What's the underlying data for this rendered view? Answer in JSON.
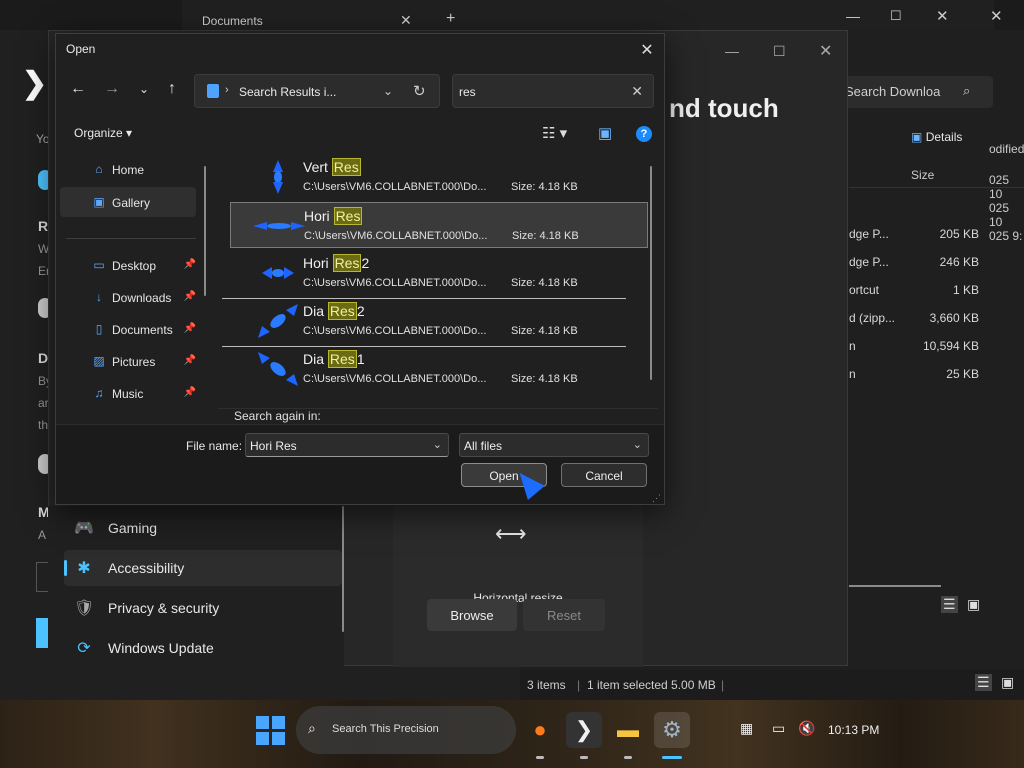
{
  "bg_explorer": {
    "tab_title": "Documents",
    "search_placeholder": "Search Downloa",
    "details_label": "Details",
    "col_size": "Size",
    "col_modified": "odified",
    "dates": [
      "025 10",
      "025 10",
      "025 9:"
    ],
    "rows": [
      {
        "name": "dge P...",
        "size": "205 KB"
      },
      {
        "name": "dge P...",
        "size": "246 KB"
      },
      {
        "name": "ortcut",
        "size": "1 KB"
      },
      {
        "name": "d (zipp...",
        "size": "3,660 KB"
      },
      {
        "name": "n",
        "size": "10,594 KB"
      },
      {
        "name": "n",
        "size": "25 KB"
      }
    ],
    "status": {
      "items": "3 items",
      "selected": "1 item selected  5.00 MB"
    }
  },
  "settings": {
    "fragments": [
      "Yo",
      "R",
      "W",
      "Er",
      "D",
      "By",
      "ar",
      "th",
      "M",
      "A"
    ],
    "nav": [
      {
        "label": "Gaming",
        "icon": "🎮"
      },
      {
        "label": "Accessibility",
        "icon": "✱"
      },
      {
        "label": "Privacy & security",
        "icon": "🛡"
      },
      {
        "label": "Windows Update",
        "icon": "⟳"
      }
    ]
  },
  "mouse_panel": {
    "heading": "nd touch",
    "preview_label": "Horizontal resize",
    "preview_glyph": "⟷",
    "browse": "Browse",
    "reset": "Reset"
  },
  "dialog": {
    "title": "Open",
    "address": "Search Results i...",
    "search_value": "res",
    "organize": "Organize",
    "sidebar": [
      {
        "label": "Home",
        "icon": "⌂",
        "pinned": false
      },
      {
        "label": "Gallery",
        "icon": "▣",
        "pinned": false
      },
      {
        "label": "Desktop",
        "icon": "▭",
        "pinned": true
      },
      {
        "label": "Downloads",
        "icon": "↓",
        "pinned": true
      },
      {
        "label": "Documents",
        "icon": "▯",
        "pinned": true
      },
      {
        "label": "Pictures",
        "icon": "▨",
        "pinned": true
      },
      {
        "label": "Music",
        "icon": "♫",
        "pinned": true
      }
    ],
    "files": [
      {
        "pre": "Vert ",
        "hl": "Res",
        "post": "",
        "path": "C:\\Users\\VM6.COLLABNET.000\\Do...",
        "size": "Size: 4.18 KB",
        "kind": "vert"
      },
      {
        "pre": "Hori ",
        "hl": "Res",
        "post": "",
        "path": "C:\\Users\\VM6.COLLABNET.000\\Do...",
        "size": "Size: 4.18 KB",
        "kind": "hori"
      },
      {
        "pre": "Hori ",
        "hl": "Res",
        "post": "2",
        "path": "C:\\Users\\VM6.COLLABNET.000\\Do...",
        "size": "Size: 4.18 KB",
        "kind": "hori2"
      },
      {
        "pre": "Dia ",
        "hl": "Res",
        "post": "2",
        "path": "C:\\Users\\VM6.COLLABNET.000\\Do...",
        "size": "Size: 4.18 KB",
        "kind": "dia2"
      },
      {
        "pre": "Dia ",
        "hl": "Res",
        "post": "1",
        "path": "C:\\Users\\VM6.COLLABNET.000\\Do...",
        "size": "Size: 4.18 KB",
        "kind": "dia1"
      }
    ],
    "search_again": "Search again in:",
    "file_name_label": "File name:",
    "file_name_value": "Hori Res",
    "file_type": "All files",
    "open_label": "Open",
    "cancel_label": "Cancel"
  },
  "taskbar": {
    "search_placeholder": "Search This Precision",
    "clock": "10:13 PM"
  },
  "colors": {
    "accent": "#4cc2ff",
    "highlight": "#6b6b13",
    "link_blue": "#1a8cff"
  }
}
